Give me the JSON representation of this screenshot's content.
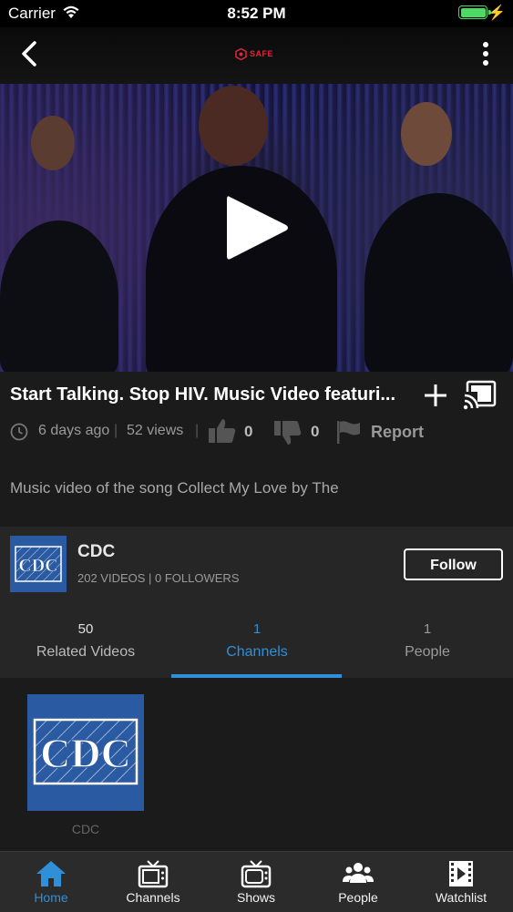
{
  "status_bar": {
    "carrier": "Carrier",
    "time": "8:52 PM",
    "battery_level": 1.0
  },
  "nav": {
    "logo_text": "SAFE",
    "back_icon": "chevron-left-icon",
    "menu_icon": "more-vertical-icon"
  },
  "video": {
    "title": "Start Talking. Stop HIV. Music Video featuri...",
    "posted": "6 days ago",
    "views": "52 views",
    "likes": "0",
    "dislikes": "0",
    "report_label": "Report",
    "description": "Music video of the song Collect My Love by The"
  },
  "channel": {
    "logo_text": "CDC",
    "name": "CDC",
    "stats": "202 VIDEOS | 0 FOLLOWERS",
    "follow_label": "Follow"
  },
  "tabs": [
    {
      "count": "50",
      "label": "Related Videos"
    },
    {
      "count": "1",
      "label": "Channels"
    },
    {
      "count": "1",
      "label": "People"
    }
  ],
  "channels_grid": [
    {
      "logo_text": "CDC",
      "label": "CDC"
    }
  ],
  "tab_bar": [
    {
      "label": "Home",
      "icon": "home-icon"
    },
    {
      "label": "Channels",
      "icon": "tv-icon"
    },
    {
      "label": "Shows",
      "icon": "tv-icon"
    },
    {
      "label": "People",
      "icon": "people-icon"
    },
    {
      "label": "Watchlist",
      "icon": "film-play-icon"
    }
  ],
  "colors": {
    "accent": "#2f8fd8",
    "background": "#1b1b1b",
    "card": "#262626",
    "brand_red": "#e0263a",
    "cdc_blue": "#2a5aa2",
    "battery": "#4cd964"
  }
}
